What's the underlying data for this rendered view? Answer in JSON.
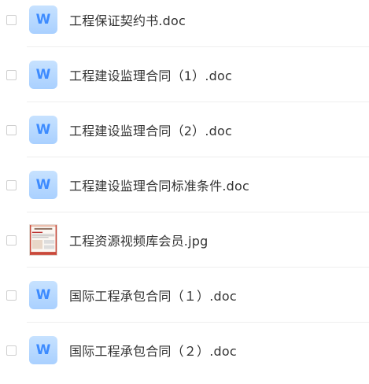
{
  "files": [
    {
      "name": "工程保证契约书.doc",
      "type": "word",
      "icon_letter": "W",
      "icon": "word-doc-icon"
    },
    {
      "name": "工程建设监理合同（1）.doc",
      "type": "word",
      "icon_letter": "W",
      "icon": "word-doc-icon"
    },
    {
      "name": "工程建设监理合同（2）.doc",
      "type": "word",
      "icon_letter": "W",
      "icon": "word-doc-icon"
    },
    {
      "name": "工程建设监理合同标准条件.doc",
      "type": "word",
      "icon_letter": "W",
      "icon": "word-doc-icon"
    },
    {
      "name": "工程资源视频库会员.jpg",
      "type": "image",
      "icon": "image-thumbnail"
    },
    {
      "name": "国际工程承包合同（１）.doc",
      "type": "word",
      "icon_letter": "W",
      "icon": "word-doc-icon"
    },
    {
      "name": "国际工程承包合同（２）.doc",
      "type": "word",
      "icon_letter": "W",
      "icon": "word-doc-icon"
    }
  ],
  "colors": {
    "word_icon_bg": "#b8d9ff",
    "word_icon_letter": "#3d8bff",
    "text": "#333333",
    "divider": "#eeeeee",
    "checkbox_border": "#cfcfcf"
  }
}
